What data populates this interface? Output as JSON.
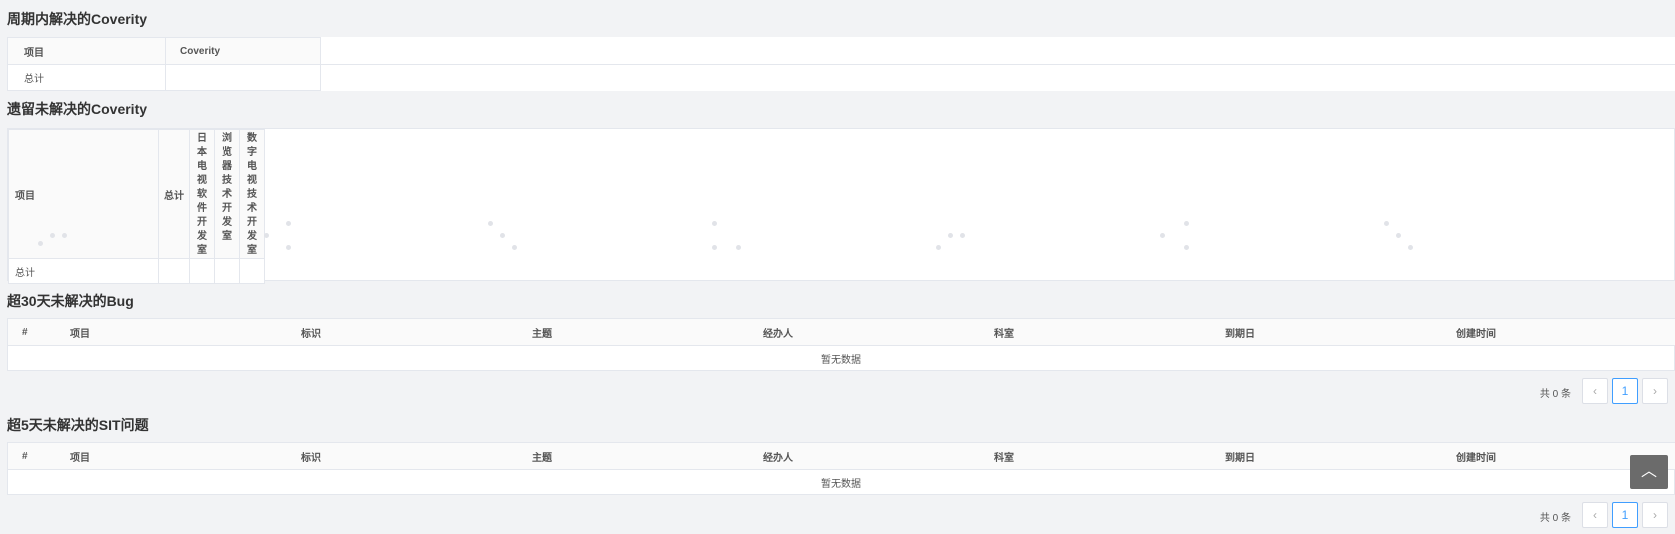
{
  "section1": {
    "title": "周期内解决的Coverity",
    "headers": [
      "项目",
      "Coverity"
    ],
    "row_label": "总计"
  },
  "section2": {
    "title": "遗留未解决的Coverity",
    "headers": [
      "项目",
      "总计"
    ],
    "vertical_headers": [
      "日本电视软件开发室",
      "浏览器技术开发室",
      "数字电视技术开发室"
    ],
    "row_label": "总计"
  },
  "section3": {
    "title": "超30天未解决的Bug",
    "headers": [
      "#",
      "项目",
      "标识",
      "主题",
      "经办人",
      "科室",
      "到期日",
      "创建时间"
    ],
    "empty_text": "暂无数据",
    "pager": {
      "total_text": "共 0 条",
      "current_page": "1",
      "prev": "‹",
      "next": "›"
    }
  },
  "section4": {
    "title": "超5天未解决的SIT问题",
    "headers": [
      "#",
      "项目",
      "标识",
      "主题",
      "经办人",
      "科室",
      "到期日",
      "创建时间"
    ],
    "empty_text": "暂无数据",
    "pager": {
      "total_text": "共 0 条",
      "current_page": "1",
      "prev": "‹",
      "next": "›"
    }
  },
  "back_to_top": {
    "icon": "chevron-up-icon",
    "glyph": "︿"
  }
}
